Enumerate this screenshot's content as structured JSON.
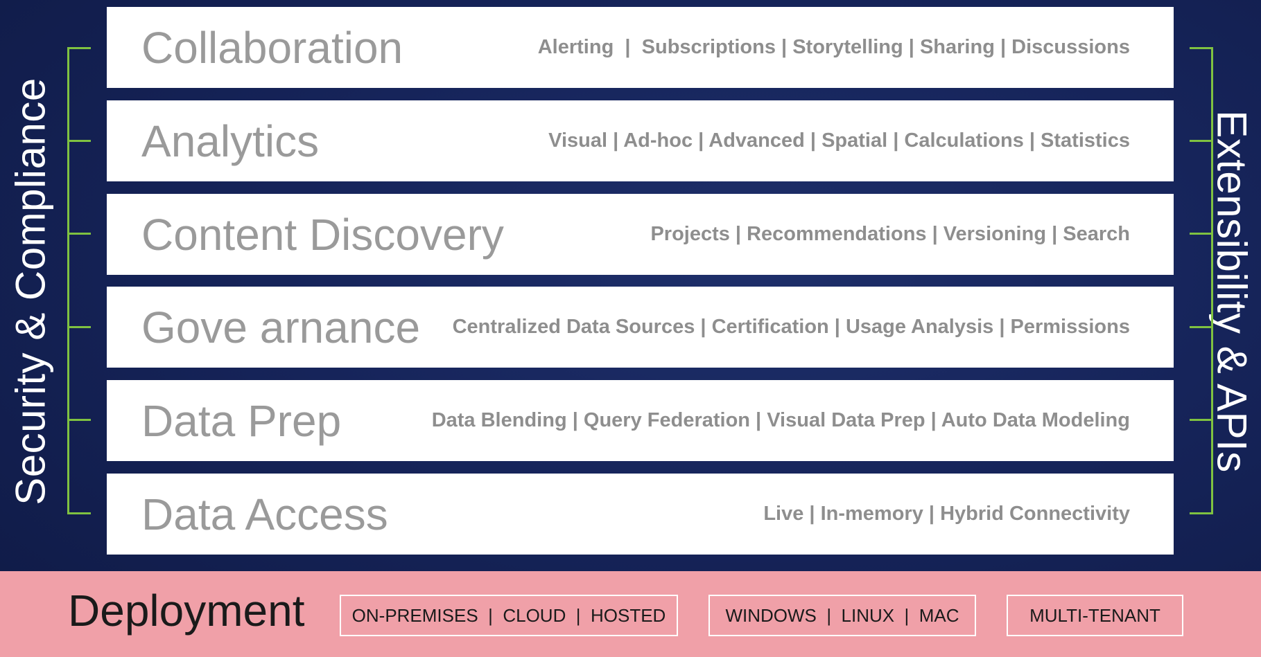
{
  "left_label": "Security & Compliance",
  "right_label": "Extensibility & APIs",
  "layers": [
    {
      "title": "Collaboration",
      "features": "Alerting  |  Subscriptions | Storytelling | Sharing | Discussions"
    },
    {
      "title": "Analytics",
      "features": "Visual | Ad-hoc | Advanced | Spatial | Calculations | Statistics"
    },
    {
      "title": "Content Discovery",
      "features": "Projects | Recommendations | Versioning | Search"
    },
    {
      "title": "Gove arnance",
      "features": "Centralized Data Sources | Certification | Usage Analysis | Permissions"
    },
    {
      "title": "Data Prep",
      "features": "Data Blending | Query Federation | Visual Data Prep | Auto Data Modeling"
    },
    {
      "title": "Data Access",
      "features": "Live | In-memory | Hybrid Connectivity"
    }
  ],
  "deployment": {
    "title": "Deployment",
    "options": [
      "ON-PREMISES  |  CLOUD  |  HOSTED",
      "WINDOWS  |  LINUX  |  MAC",
      "MULTI-TENANT"
    ]
  },
  "colors": {
    "background": "#16245a",
    "bracket": "#7fc241",
    "deployment_band": "#f0a0a8",
    "layer_title": "#9a9a9a",
    "layer_features": "#8e8e8e"
  }
}
